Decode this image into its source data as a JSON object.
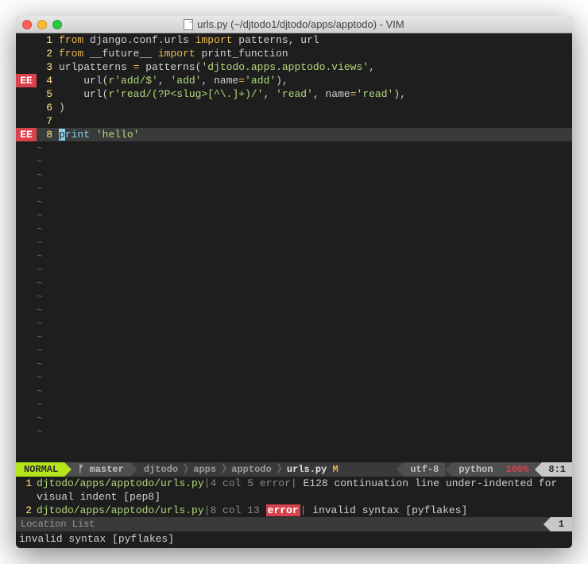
{
  "window": {
    "title": "urls.py (~/djtodo1/djtodo/apps/apptodo) - VIM"
  },
  "code": {
    "lines": [
      {
        "num": "1",
        "err": "",
        "tokens": [
          {
            "c": "kw",
            "t": "from"
          },
          {
            "c": "",
            "t": " "
          },
          {
            "c": "id",
            "t": "django.conf.urls"
          },
          {
            "c": "",
            "t": " "
          },
          {
            "c": "kw",
            "t": "import"
          },
          {
            "c": "",
            "t": " "
          },
          {
            "c": "id",
            "t": "patterns, url"
          }
        ]
      },
      {
        "num": "2",
        "err": "",
        "tokens": [
          {
            "c": "kw",
            "t": "from"
          },
          {
            "c": "",
            "t": " "
          },
          {
            "c": "id",
            "t": "__future__"
          },
          {
            "c": "",
            "t": " "
          },
          {
            "c": "kw",
            "t": "import"
          },
          {
            "c": "",
            "t": " "
          },
          {
            "c": "id",
            "t": "print_function"
          }
        ]
      },
      {
        "num": "3",
        "err": "",
        "tokens": [
          {
            "c": "id",
            "t": "urlpatterns "
          },
          {
            "c": "eq",
            "t": "="
          },
          {
            "c": "id",
            "t": " patterns("
          },
          {
            "c": "str",
            "t": "'djtodo.apps.apptodo.views'"
          },
          {
            "c": "id",
            "t": ","
          }
        ]
      },
      {
        "num": "4",
        "err": "EE",
        "tokens": [
          {
            "c": "",
            "t": "    "
          },
          {
            "c": "id",
            "t": "url("
          },
          {
            "c": "str",
            "t": "r'add/$'"
          },
          {
            "c": "id",
            "t": ", "
          },
          {
            "c": "str",
            "t": "'add'"
          },
          {
            "c": "id",
            "t": ", name"
          },
          {
            "c": "eq",
            "t": "="
          },
          {
            "c": "str",
            "t": "'add'"
          },
          {
            "c": "id",
            "t": "),"
          }
        ]
      },
      {
        "num": "5",
        "err": "",
        "tokens": [
          {
            "c": "",
            "t": "    "
          },
          {
            "c": "id",
            "t": "url("
          },
          {
            "c": "str",
            "t": "r'read/(?P<slug>[^\\.]+)/'"
          },
          {
            "c": "id",
            "t": ", "
          },
          {
            "c": "str",
            "t": "'read'"
          },
          {
            "c": "id",
            "t": ", name"
          },
          {
            "c": "eq",
            "t": "="
          },
          {
            "c": "str",
            "t": "'read'"
          },
          {
            "c": "id",
            "t": "),"
          }
        ]
      },
      {
        "num": "6",
        "err": "",
        "tokens": [
          {
            "c": "id",
            "t": ")"
          }
        ]
      },
      {
        "num": "7",
        "err": "",
        "tokens": []
      },
      {
        "num": "8",
        "err": "EE",
        "cur": true,
        "tokens": [
          {
            "c": "cursor",
            "t": "p"
          },
          {
            "c": "fn",
            "t": "rint"
          },
          {
            "c": "",
            "t": " "
          },
          {
            "c": "str",
            "t": "'hello'"
          }
        ]
      }
    ],
    "tildes": 22
  },
  "status": {
    "mode": "NORMAL",
    "branch_icon": "ᚠ",
    "branch": "master",
    "path_segments": [
      "djtodo",
      "apps",
      "apptodo"
    ],
    "file": "urls.py",
    "modified": "M",
    "encoding": "utf-8",
    "filetype": "python",
    "percent": "100%",
    "position": "8:1"
  },
  "location_list": {
    "items": [
      {
        "num": "1",
        "path": "djtodo/apps/apptodo/urls.py",
        "loc": "4 col 5",
        "tag": "error",
        "msg": "E128 continuation line under-indented for visual indent [pep8]"
      },
      {
        "num": "2",
        "path": "djtodo/apps/apptodo/urls.py",
        "loc": "8 col 13",
        "tag": "error",
        "msg": "invalid syntax [pyflakes]",
        "badge": true
      }
    ],
    "label": "Location List",
    "count": "1"
  },
  "cmdline": "invalid syntax [pyflakes]"
}
